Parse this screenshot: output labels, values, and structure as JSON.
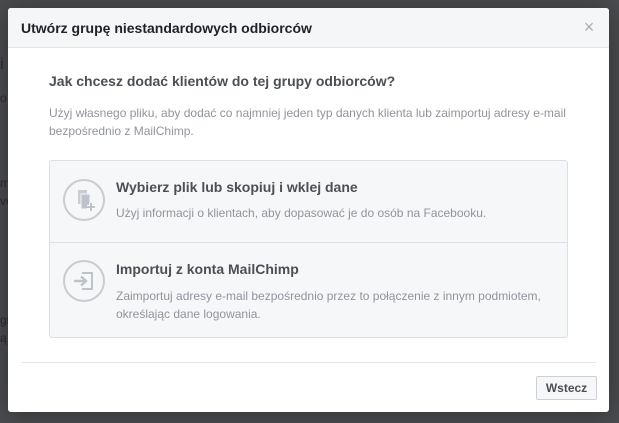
{
  "background": {
    "fragments": [
      "i",
      "o",
      "m",
      "vo",
      "gr",
      "ą"
    ]
  },
  "modal": {
    "title": "Utwórz grupę niestandardowych odbiorców",
    "close_glyph": "×",
    "question": "Jak chcesz dodać klientów do tej grupy odbiorców?",
    "description": "Użyj własnego pliku, aby dodać co najmniej jeden typ danych klienta lub zaimportuj adresy e-mail bezpośrednio z MailChimp.",
    "options": [
      {
        "title": "Wybierz plik lub skopiuj i wklej dane",
        "description": "Użyj informacji o klientach, aby dopasować je do osób na Facebooku.",
        "icon": "file-add-icon"
      },
      {
        "title": "Importuj z konta MailChimp",
        "description": "Zaimportuj adresy e-mail bezpośrednio przez to połączenie z innym podmiotem, określając dane logowania.",
        "icon": "import-icon"
      }
    ],
    "back_label": "Wstecz"
  },
  "colors": {
    "overlay": "#4b4c4f",
    "header_bg": "#f5f6f7",
    "title_text": "#1d2129",
    "body_text": "#4b4f56",
    "muted_text": "#90949c",
    "border": "#dddfe2",
    "icon_stroke": "#c9ccd1"
  }
}
